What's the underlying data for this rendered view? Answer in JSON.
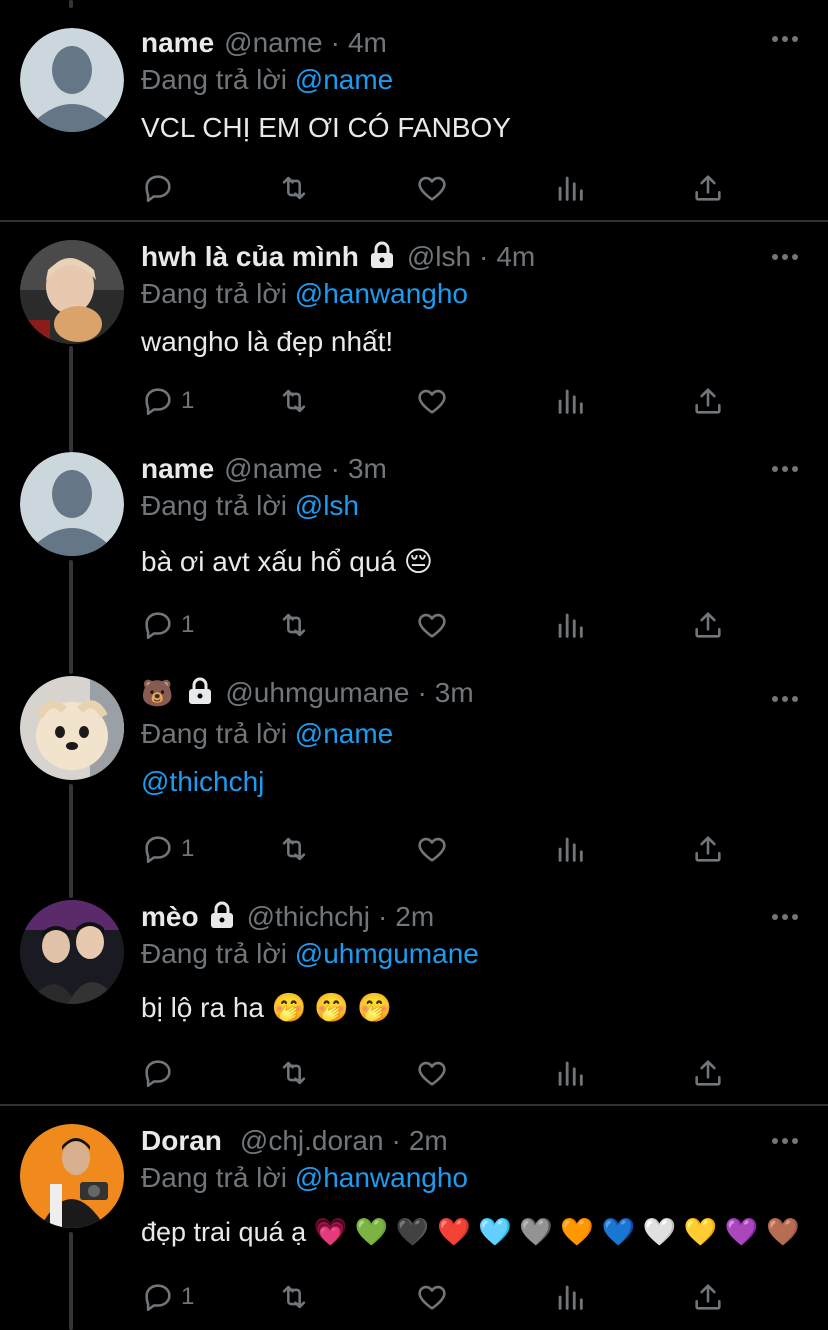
{
  "tweets": [
    {
      "name": "name",
      "handle": "@name",
      "time": "4m",
      "reply_prefix": "Đang trả lời",
      "reply_to": "@name",
      "text": "VCL CHỊ EM ƠI CÓ FANBOY",
      "reply_count": "",
      "avatar": "default-avatar",
      "locked": false
    },
    {
      "name": "hwh là của mình",
      "handle": "@lsh",
      "time": "4m",
      "reply_prefix": "Đang trả lời",
      "reply_to": "@hanwangho",
      "text": "wangho là đẹp nhất!",
      "reply_count": "1",
      "avatar": "photo-avatar",
      "locked": true
    },
    {
      "name": "name",
      "handle": "@name",
      "time": "3m",
      "reply_prefix": "Đang trả lời",
      "reply_to": "@lsh",
      "text": "bà ơi avt xấu hổ quá 😔",
      "reply_count": "1",
      "avatar": "default-avatar",
      "locked": false
    },
    {
      "name": "🐻",
      "handle": "@uhmgumane",
      "time": "3m",
      "reply_prefix": "Đang trả lời",
      "reply_to": "@name",
      "text": "@thichchj",
      "reply_count": "1",
      "avatar": "dog-avatar",
      "locked": true
    },
    {
      "name": "mèo",
      "handle": "@thichchj",
      "time": "2m",
      "reply_prefix": "Đang trả lời",
      "reply_to": "@uhmgumane",
      "text": "bị lộ ra ha 🤭 🤭 🤭",
      "reply_count": "",
      "avatar": "photo-avatar",
      "locked": true
    },
    {
      "name": "Doran",
      "handle": "@chj.doran",
      "time": "2m",
      "reply_prefix": "Đang trả lời",
      "reply_to": "@hanwangho",
      "text": "đẹp trai quá ạ 💗 💚 🖤 ❤️ 🩵 🩶 🧡 💙 🤍 💛 💜 🤎",
      "reply_count": "1",
      "avatar": "photo-avatar-orange",
      "locked": false
    }
  ],
  "dot": "·",
  "colors": {
    "background": "#000000",
    "text": "#e7e9ea",
    "muted": "#71767b",
    "link": "#1d9bf0",
    "separator": "#2f3336"
  },
  "icons": [
    "reply-icon",
    "retweet-icon",
    "like-icon",
    "analytics-icon",
    "share-icon",
    "more-icon",
    "lock-icon"
  ]
}
